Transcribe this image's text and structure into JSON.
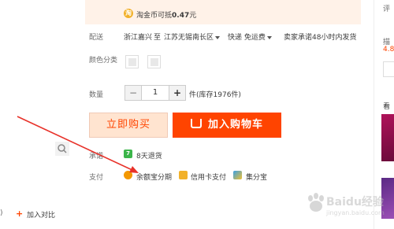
{
  "banner": {
    "coin_symbol": "淘",
    "text_prefix": "淘金币可抵",
    "amount": "0.47",
    "text_suffix": "元"
  },
  "shipping": {
    "label": "配送",
    "origin": "浙江嘉兴",
    "to": "至",
    "destination": "江苏无锡南长区",
    "express": "快递",
    "fee": "免运费",
    "promise": "卖家承诺48小时内发货"
  },
  "color": {
    "label": "颜色分类"
  },
  "quantity": {
    "label": "数量",
    "minus": "−",
    "value": "1",
    "plus": "+",
    "stock": "件(库存1976件)"
  },
  "actions": {
    "buy_now": "立即购买",
    "add_to_cart": "加入购物车"
  },
  "promise": {
    "label": "承诺",
    "badge": "7",
    "text": "8天退货"
  },
  "payment": {
    "label": "支付",
    "methods": [
      {
        "name": "余额宝分期",
        "color": "#f39800"
      },
      {
        "name": "信用卡支付",
        "color": "#f2b12a"
      },
      {
        "name": "集分宝",
        "color": "#39a0e6"
      }
    ]
  },
  "left": {
    "compare": "加入对比",
    "paren": ")"
  },
  "right": {
    "top_char": "评",
    "label_bottom": "描",
    "score": "4.8",
    "look": "看"
  },
  "colors": {
    "accent": "#ff4400",
    "banner_bg": "#fff2e8",
    "buy_bg": "#ffe4d0",
    "promise_green": "#3bb54a",
    "arrow_red": "#e8322a"
  },
  "watermark": {
    "text": "Baidu经验",
    "sub": "jingyan.baidu.com"
  }
}
